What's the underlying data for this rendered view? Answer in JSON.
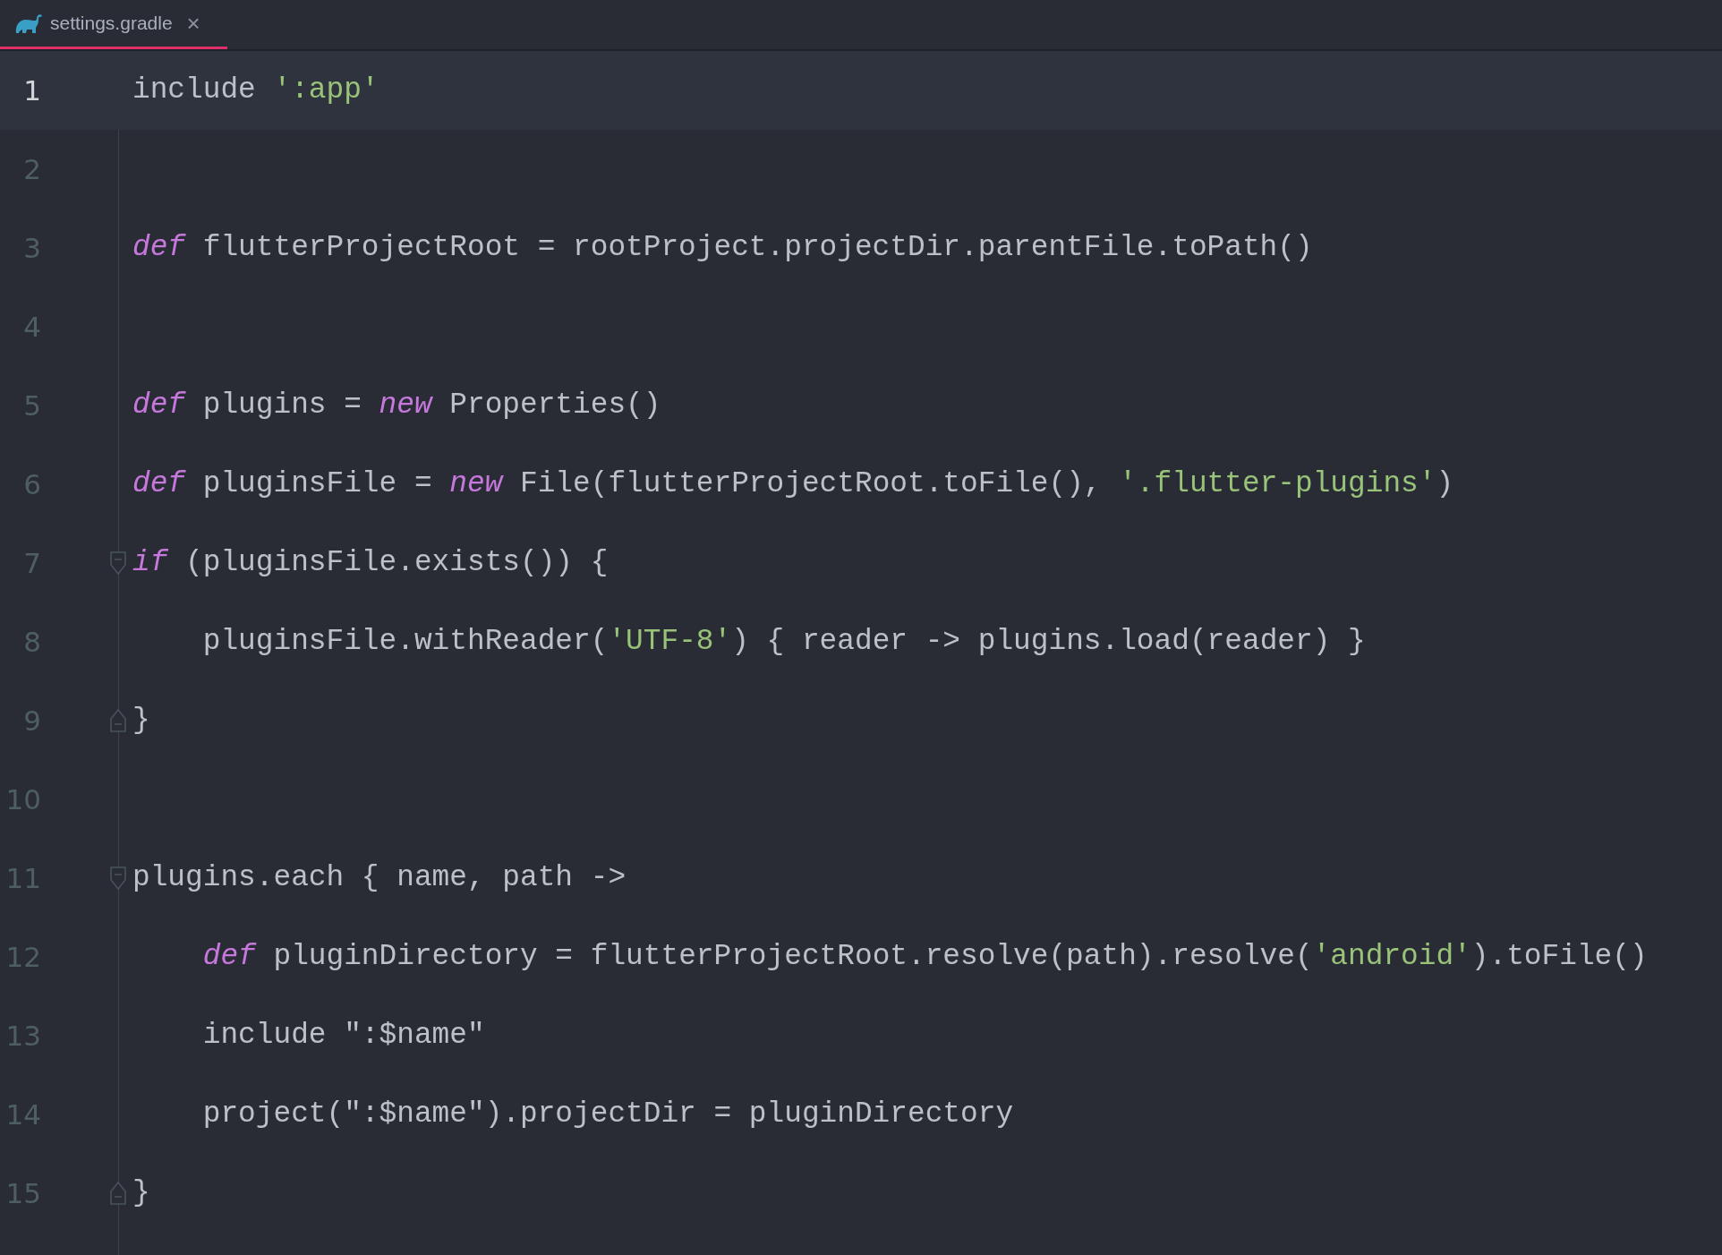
{
  "tabs": [
    {
      "label": "settings.gradle",
      "close": "×",
      "selected": true
    }
  ],
  "editor": {
    "lines": [
      {
        "number": "1",
        "current": true,
        "kind": "plain",
        "tokens": [
          {
            "kind": "plain",
            "text": "include "
          },
          {
            "kind": "string",
            "text": "':app'"
          }
        ]
      },
      {
        "number": "2",
        "current": false,
        "kind": "plain"
      },
      {
        "number": "3",
        "current": false,
        "kind": "plain",
        "tokens": [
          {
            "kind": "keyword",
            "text": "def"
          },
          {
            "kind": "plain",
            "text": " flutterProjectRoot = rootProject.projectDir.parentFile.toPath()"
          }
        ]
      },
      {
        "number": "4",
        "current": false,
        "kind": "plain"
      },
      {
        "number": "5",
        "current": false,
        "kind": "plain",
        "tokens": [
          {
            "kind": "keyword",
            "text": "def"
          },
          {
            "kind": "plain",
            "text": " plugins = "
          },
          {
            "kind": "keyword",
            "text": "new"
          },
          {
            "kind": "plain",
            "text": " Properties()"
          }
        ]
      },
      {
        "number": "6",
        "current": false,
        "kind": "plain",
        "tokens": [
          {
            "kind": "keyword",
            "text": "def"
          },
          {
            "kind": "plain",
            "text": " pluginsFile = "
          },
          {
            "kind": "keyword",
            "text": "new"
          },
          {
            "kind": "plain",
            "text": " File(flutterProjectRoot.toFile(), "
          },
          {
            "kind": "string",
            "text": "'.flutter-plugins'"
          },
          {
            "kind": "plain",
            "text": ")"
          }
        ]
      },
      {
        "number": "7",
        "current": false,
        "kind": "opener",
        "tokens": [
          {
            "kind": "keyword",
            "text": "if"
          },
          {
            "kind": "plain",
            "text": " (pluginsFile.exists()) {"
          }
        ]
      },
      {
        "number": "8",
        "current": false,
        "kind": "plain",
        "tokens": [
          {
            "kind": "plain",
            "text": "    pluginsFile.withReader("
          },
          {
            "kind": "string",
            "text": "'UTF-8'"
          },
          {
            "kind": "plain",
            "text": ") { reader -> plugins.load(reader) }"
          }
        ]
      },
      {
        "number": "9",
        "current": false,
        "kind": "closer",
        "tokens": [
          {
            "kind": "plain",
            "text": "}"
          }
        ]
      },
      {
        "number": "10",
        "current": false,
        "kind": "plain"
      },
      {
        "number": "11",
        "current": false,
        "kind": "opener",
        "tokens": [
          {
            "kind": "plain",
            "text": "plugins.each { name, path ->"
          }
        ]
      },
      {
        "number": "12",
        "current": false,
        "kind": "plain",
        "tokens": [
          {
            "kind": "keyword",
            "text": "    def"
          },
          {
            "kind": "plain",
            "text": " pluginDirectory = flutterProjectRoot.resolve(path).resolve("
          },
          {
            "kind": "string",
            "text": "'android'"
          },
          {
            "kind": "plain",
            "text": ").toFile()"
          }
        ]
      },
      {
        "number": "13",
        "current": false,
        "kind": "plain",
        "tokens": [
          {
            "kind": "plain",
            "text": "    include \":$name\""
          }
        ]
      },
      {
        "number": "14",
        "current": false,
        "kind": "plain",
        "tokens": [
          {
            "kind": "plain",
            "text": "    project(\":$name\").projectDir = pluginDirectory"
          }
        ]
      },
      {
        "number": "15",
        "current": false,
        "kind": "closer",
        "tokens": [
          {
            "kind": "plain",
            "text": "}"
          }
        ]
      }
    ]
  }
}
